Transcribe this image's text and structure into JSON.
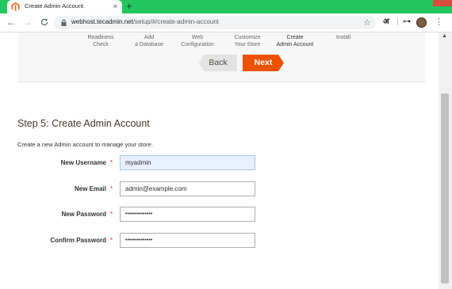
{
  "browser": {
    "tab_title": "Create Admin Account",
    "tab_close": "×",
    "new_tab": "+",
    "back_icon": "←",
    "forward_icon": "→",
    "reload_icon": "C",
    "url_host": "webhost.tecadmin.net",
    "url_path": "/setup/#/create-admin-account",
    "star_icon": "☆",
    "translate_ext": "अ",
    "key_ext": "⊶",
    "puzzle_ext": "⋮",
    "menu_icon": "⋮"
  },
  "wizard": {
    "steps": [
      {
        "label": "Readiness\nCheck",
        "active": false
      },
      {
        "label": "Add\na Database",
        "active": false
      },
      {
        "label": "Web\nConfiguration",
        "active": false
      },
      {
        "label": "Customize\nYour Store",
        "active": false
      },
      {
        "label": "Create\nAdmin Account",
        "active": true
      },
      {
        "label": "Install",
        "active": false
      }
    ],
    "back_label": "Back",
    "next_label": "Next"
  },
  "form": {
    "title": "Step 5: Create Admin Account",
    "intro": "Create a new Admin account to manage your store.",
    "required_mark": "*",
    "fields": [
      {
        "label": "New Username",
        "value": "myadmin"
      },
      {
        "label": "New Email",
        "value": "admin@example.com"
      },
      {
        "label": "New Password",
        "value": "••••••••••••••"
      },
      {
        "label": "Confirm Password",
        "value": "••••••••••••••"
      }
    ]
  },
  "colors": {
    "titlebar": "#22c55e",
    "accent_next": "#eb5202",
    "required": "#e22626"
  }
}
